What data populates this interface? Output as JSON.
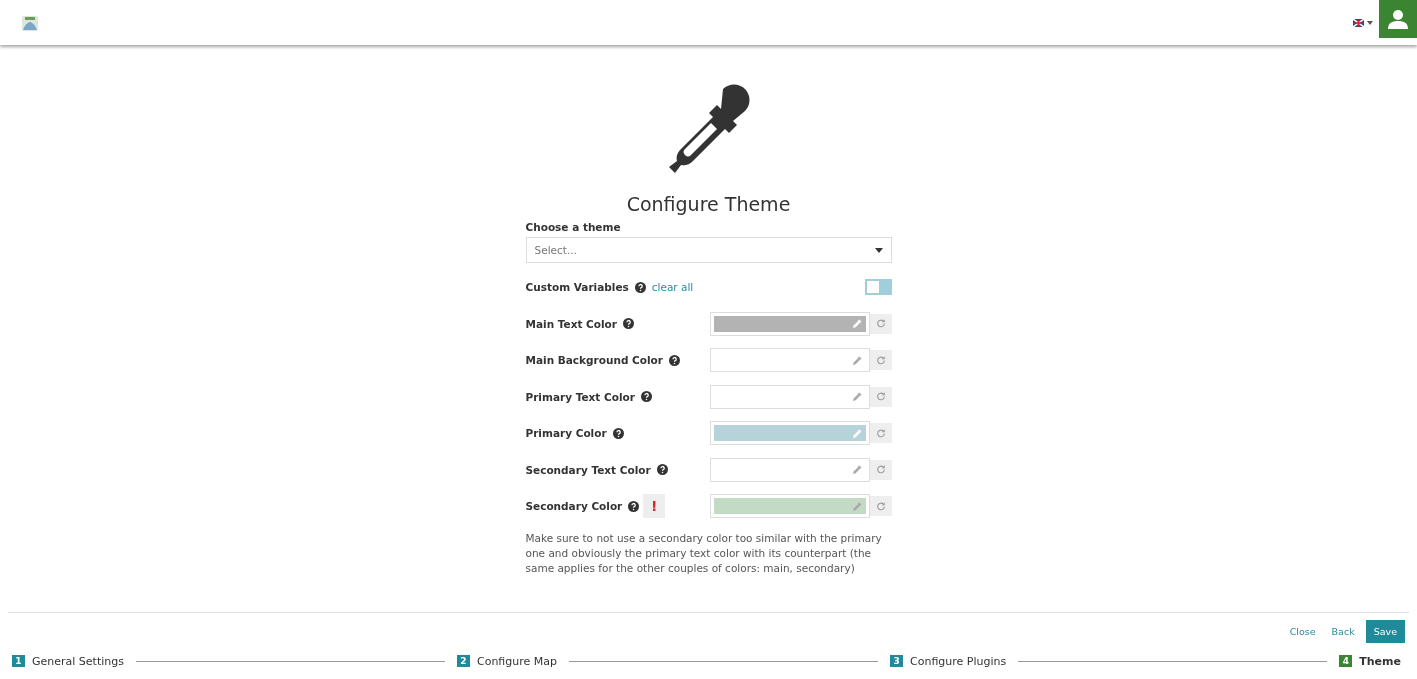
{
  "header": {
    "language_menu": {
      "expanded": false
    }
  },
  "title": "Configure Theme",
  "theme_select": {
    "label": "Choose a theme",
    "placeholder": "Select..."
  },
  "custom_variables": {
    "label": "Custom Variables",
    "link": "clear all",
    "on": false
  },
  "colors": [
    {
      "label": "Main Text Color",
      "color": "#b3b3b3",
      "warning": false
    },
    {
      "label": "Main Background Color",
      "warning": false
    },
    {
      "label": "Primary Text Color",
      "warning": false
    },
    {
      "label": "Primary Color",
      "color": "#b7d3da",
      "warning": false
    },
    {
      "label": "Secondary Text Color",
      "warning": false
    },
    {
      "label": "Secondary Color",
      "color": "#c3dac5",
      "warning": true
    }
  ],
  "warning_mark": "!",
  "note": "Make sure to not use a secondary color too similar with the primary one and obviously the primary text color with its counterpart (the same applies for the other couples of colors: main, secondary)",
  "footer_buttons": [
    {
      "label": "Close",
      "kind": "link"
    },
    {
      "label": "Back",
      "kind": "link"
    },
    {
      "label": "Save",
      "kind": "primary"
    }
  ],
  "steps": [
    {
      "number": "1",
      "label": "General Settings",
      "selected": false
    },
    {
      "number": "2",
      "label": "Configure Map",
      "selected": false
    },
    {
      "number": "3",
      "label": "Configure Plugins",
      "selected": false
    },
    {
      "number": "4",
      "label": "Theme",
      "selected": true
    }
  ]
}
